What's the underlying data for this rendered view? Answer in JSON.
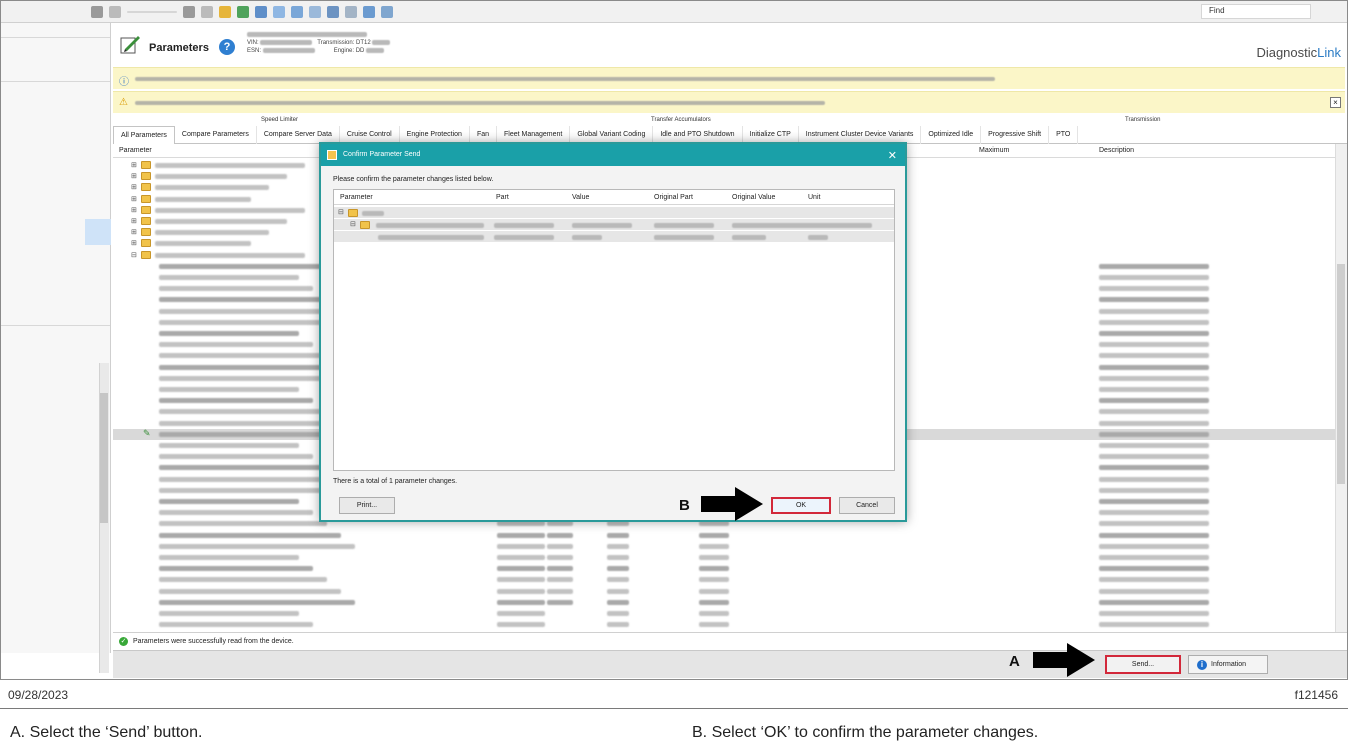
{
  "toolbar": {
    "find_label": "Find"
  },
  "header": {
    "title": "Parameters",
    "vin_label": "VIN:",
    "esn_label": "ESN:",
    "transmission_label": "Transmission: DT12",
    "engine_label": "Engine: DD",
    "brand_prefix": "Diagnostic",
    "brand_suffix": "Link"
  },
  "tab_groups": {
    "speed_limiter": "Speed Limiter",
    "transfer_accumulators": "Transfer Accumulators",
    "transmission": "Transmission"
  },
  "tabs": [
    "All Parameters",
    "Compare Parameters",
    "Compare Server Data",
    "Cruise Control",
    "Engine Protection",
    "Fan",
    "Fleet Management",
    "Global Variant Coding",
    "Idle and PTO Shutdown",
    "Initialize CTP",
    "Instrument Cluster Device Variants",
    "Optimized Idle",
    "Progressive Shift",
    "PTO"
  ],
  "grid": {
    "col_parameter": "Parameter",
    "col_maximum": "Maximum",
    "col_description": "Description"
  },
  "status": {
    "message": "Parameters were successfully read from the device."
  },
  "bottom": {
    "send_label": "Send...",
    "information_label": "Information"
  },
  "dialog": {
    "title": "Confirm Parameter Send",
    "message": "Please confirm the parameter changes listed below.",
    "columns": {
      "parameter": "Parameter",
      "part": "Part",
      "value": "Value",
      "original_part": "Original Part",
      "original_value": "Original Value",
      "unit": "Unit"
    },
    "total": "There is a total of 1 parameter changes.",
    "print_label": "Print...",
    "ok_label": "OK",
    "cancel_label": "Cancel"
  },
  "callouts": {
    "a": "A",
    "b": "B"
  },
  "footer": {
    "date": "09/28/2023",
    "figure_code": "f121456",
    "caption_a": "A. Select the ‘Send’ button.",
    "caption_b": "B. Select ‘OK’ to confirm the parameter changes."
  },
  "colors": {
    "accent_teal": "#1aa0a8",
    "highlight_red": "#d2283a",
    "notice_yellow": "#fbf6c8"
  }
}
